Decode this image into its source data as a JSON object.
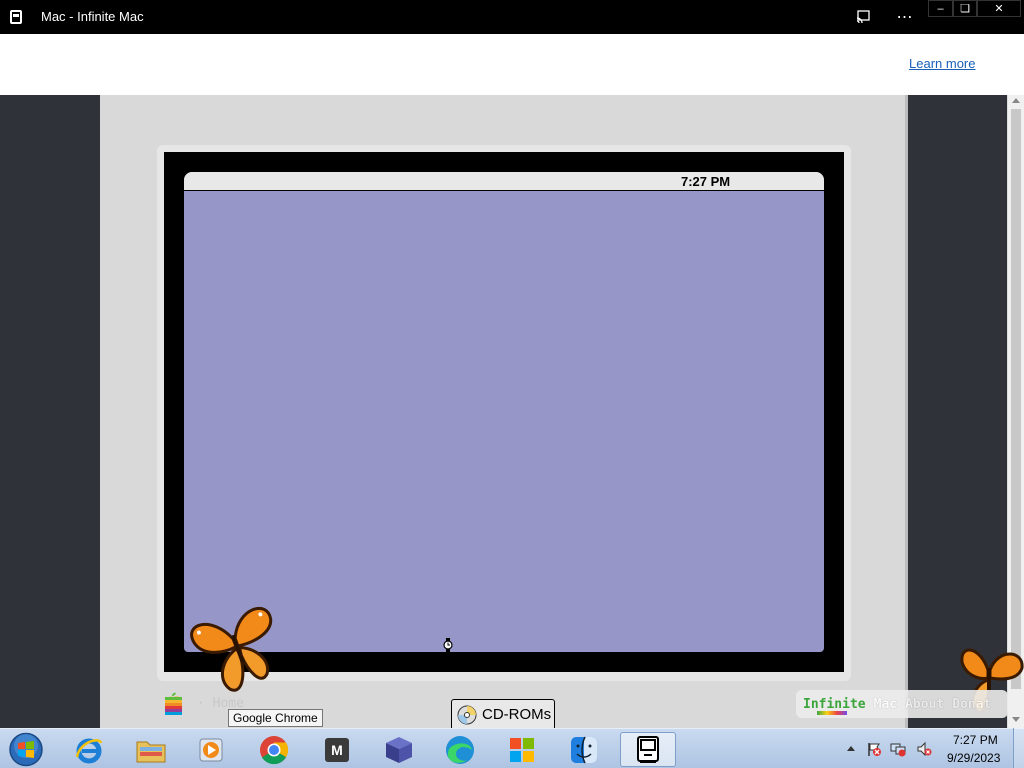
{
  "window": {
    "title": "Mac - Infinite Mac",
    "more_label": "⋯",
    "min_label": "–",
    "max_label": "❏",
    "close_label": "✕"
  },
  "infobar": {
    "link_label": "Learn more"
  },
  "mac": {
    "menubar_clock": "7:27 PM",
    "bottom_home_label": "· Home",
    "cdroms_label": "CD-ROMs"
  },
  "im_nav": {
    "brand_part1": "Infinite",
    "brand_part2": "Mac",
    "about_label": "About",
    "donate_label": "Donat"
  },
  "tooltip": {
    "text": "Google Chrome"
  },
  "taskbar": {
    "apps": [
      {
        "name": "Internet Explorer",
        "icon": "ie-icon"
      },
      {
        "name": "File Explorer",
        "icon": "folder-icon"
      },
      {
        "name": "Media Player",
        "icon": "media-player-icon"
      },
      {
        "name": "Google Chrome",
        "icon": "chrome-icon"
      },
      {
        "name": "M App",
        "icon": "m-app-icon"
      },
      {
        "name": "3D App",
        "icon": "cube-icon"
      },
      {
        "name": "Microsoft Edge",
        "icon": "edge-icon"
      },
      {
        "name": "Microsoft Store",
        "icon": "store-icon"
      },
      {
        "name": "Finder",
        "icon": "finder-icon"
      },
      {
        "name": "Infinite Mac",
        "icon": "mac-icon"
      }
    ],
    "m_letter": "M",
    "clock_time": "7:27 PM",
    "clock_date": "9/29/2023"
  },
  "colors": {
    "mac_desktop": "#9697c8",
    "taskbar": "#bcd0eb",
    "link": "#1a5eb8"
  }
}
